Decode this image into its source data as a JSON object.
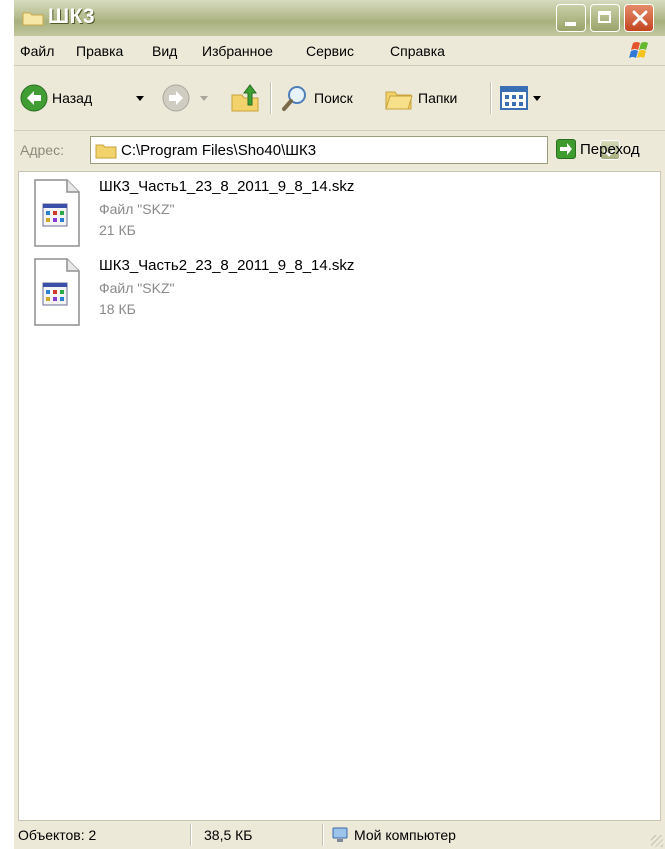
{
  "window": {
    "title": "ШК3",
    "title_icon": "folder-icon",
    "controls": [
      "minimize",
      "maximize",
      "close"
    ]
  },
  "menu": {
    "items": [
      "Файл",
      "Правка",
      "Вид",
      "Избранное",
      "Сервис",
      "Справка"
    ]
  },
  "toolbar": {
    "back_label": "Назад",
    "search_label": "Поиск",
    "folders_label": "Папки"
  },
  "address": {
    "label": "Адрес:",
    "path": "C:\\Program Files\\Sho40\\ШК3",
    "go_label": "Переход"
  },
  "files": [
    {
      "name": "ШК3_Часть1_23_8_2011_9_8_14.skz",
      "type": "Файл \"SKZ\"",
      "size": "21 КБ"
    },
    {
      "name": "ШК3_Часть2_23_8_2011_9_8_14.skz",
      "type": "Файл \"SKZ\"",
      "size": "18 КБ"
    }
  ],
  "status": {
    "objects": "Объектов: 2",
    "total_size": "38,5 КБ",
    "location": "Мой компьютер"
  },
  "colors": {
    "titlebar": "#b7bd8f",
    "chrome": "#ece9d8",
    "close_button": "#c3461f",
    "secondary_text": "#8a8a8a"
  }
}
